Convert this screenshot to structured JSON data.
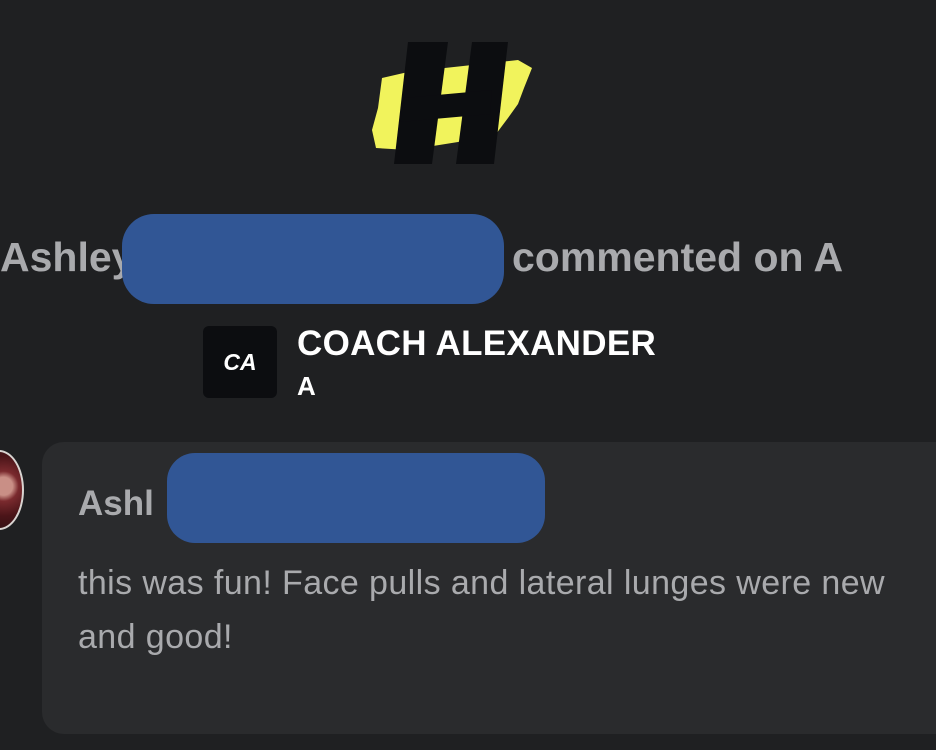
{
  "notification": {
    "user_name": "Ashley",
    "action_text": "commented on A"
  },
  "coach": {
    "badge_text": "CA",
    "name": "COACH ALEXANDER",
    "subtitle": "A"
  },
  "comment": {
    "author": "Ashl",
    "text": "this was fun! Face pulls and lateral lunges were new and good!"
  },
  "colors": {
    "background": "#1f2022",
    "card": "#2a2b2d",
    "muted_text": "#a9aaad",
    "brand_yellow": "#f1f35c",
    "redaction": "#315695"
  },
  "icons": {
    "brand_logo": "h-logo-icon",
    "avatar": "user-avatar"
  }
}
